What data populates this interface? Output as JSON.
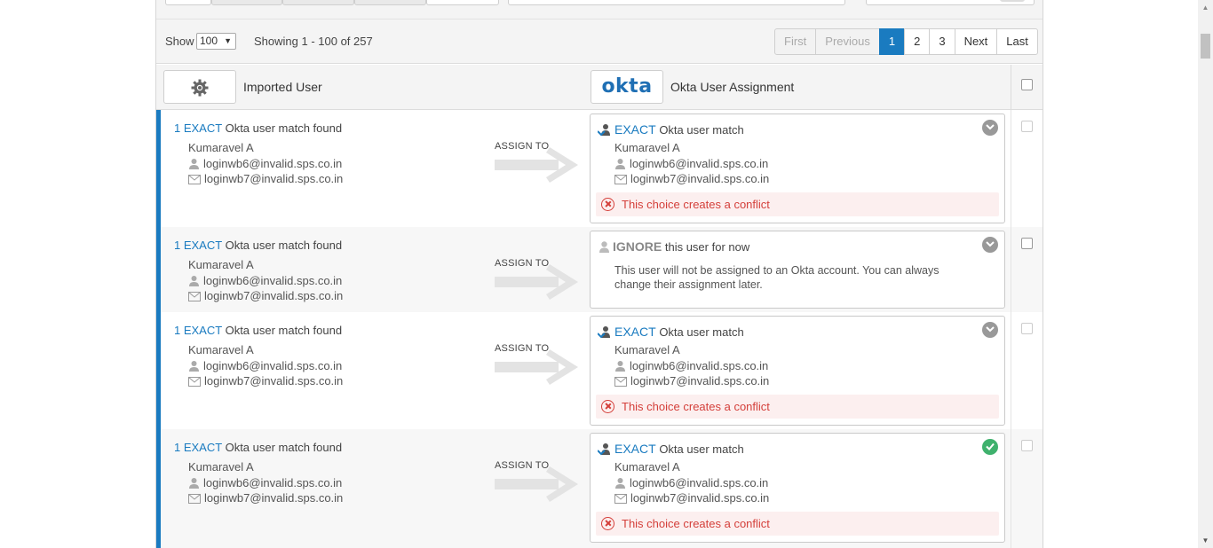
{
  "pager": {
    "show_label": "Show",
    "show_value": "100",
    "showing_text": "Showing 1 - 100 of 257",
    "buttons": [
      "First",
      "Previous",
      "1",
      "2",
      "3",
      "Next",
      "Last"
    ]
  },
  "header": {
    "imported_user": "Imported User",
    "okta_logo": "okta",
    "okta_assignment": "Okta User Assignment"
  },
  "rows": [
    {
      "match_count": "1 EXACT",
      "match_text": "Okta user match found",
      "name": "Kumaravel A",
      "login": "loginwb6@invalid.sps.co.in",
      "email": "loginwb7@invalid.sps.co.in",
      "assign_to": "ASSIGN TO",
      "card": {
        "keyword": "EXACT",
        "title_rest": "Okta user match",
        "name": "Kumaravel A",
        "login": "loginwb6@invalid.sps.co.in",
        "email": "loginwb7@invalid.sps.co.in",
        "conflict": "This choice creates a conflict"
      }
    },
    {
      "match_count": "1 EXACT",
      "match_text": "Okta user match found",
      "name": "Kumaravel A",
      "login": "loginwb6@invalid.sps.co.in",
      "email": "loginwb7@invalid.sps.co.in",
      "assign_to": "ASSIGN TO",
      "card": {
        "keyword": "IGNORE",
        "title_rest": "this user for now",
        "body": "This user will not be assigned to an Okta account. You can always change their assignment later."
      }
    },
    {
      "match_count": "1 EXACT",
      "match_text": "Okta user match found",
      "name": "Kumaravel A",
      "login": "loginwb6@invalid.sps.co.in",
      "email": "loginwb7@invalid.sps.co.in",
      "assign_to": "ASSIGN TO",
      "card": {
        "keyword": "EXACT",
        "title_rest": "Okta user match",
        "name": "Kumaravel A",
        "login": "loginwb6@invalid.sps.co.in",
        "email": "loginwb7@invalid.sps.co.in",
        "conflict": "This choice creates a conflict"
      }
    },
    {
      "match_count": "1 EXACT",
      "match_text": "Okta user match found",
      "name": "Kumaravel A",
      "login": "loginwb6@invalid.sps.co.in",
      "email": "loginwb7@invalid.sps.co.in",
      "assign_to": "ASSIGN TO",
      "card": {
        "keyword": "EXACT",
        "title_rest": "Okta user match",
        "name": "Kumaravel A",
        "login": "loginwb6@invalid.sps.co.in",
        "email": "loginwb7@invalid.sps.co.in",
        "conflict": "This choice creates a conflict"
      }
    }
  ],
  "colors": {
    "accent": "#1a7bc0",
    "conflict": "#d43f3a",
    "success": "#3fb16d"
  }
}
